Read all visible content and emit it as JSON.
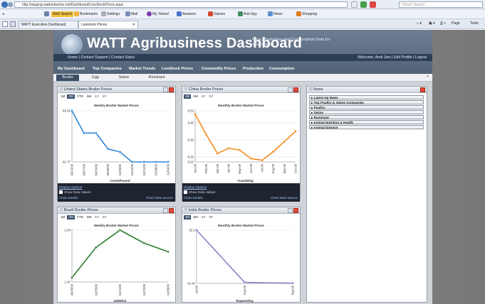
{
  "browser": {
    "url": "http://staging.wattnetworks.net/Dashboard/LiveStockPrices.aspx",
    "search_placeholder": "Yahoo! Search",
    "toolbar": [
      "Web Search",
      "Bookmarks",
      "Settings",
      "Mail",
      "My Yahoo!",
      "Answers",
      "Games",
      "Anti-Spy",
      "News",
      "Shopping"
    ],
    "tabs": [
      "WATT Executive Dashboard",
      "Livestock Prices"
    ],
    "right_tools": [
      "Page",
      "Tools"
    ]
  },
  "header": {
    "title": "WATT Agribusiness Dashboard",
    "subtitle": "Price, Production and Consumption Data for Your World",
    "topnav_left": "Home | Contact Support | Contact Sales",
    "topnav_right": "Welcome, Amit Jain | Edit Profile | Logout"
  },
  "mainnav": [
    "My Dashboard",
    "Top Companies",
    "Market Trends",
    "LiveStock Prices",
    "Commodity Prices",
    "Production",
    "Consumption"
  ],
  "subnav": [
    "Broiler",
    "Egg",
    "Swine",
    "Ruminant"
  ],
  "footer_labels": {
    "display_options": "Display Options",
    "show_values": "Show Data Values",
    "chart_details": "Chart Details",
    "chart_source": "Chart Data Source"
  },
  "panels": {
    "us": {
      "title": "United States Broiler Prices",
      "ranges": [
        "1M",
        "3M",
        "YTD",
        "6M",
        "1Y",
        "2Y"
      ],
      "selected": "3M"
    },
    "china": {
      "title": "China Broiler Prices",
      "ranges": [
        "3M",
        "6M",
        "1Y",
        "2Y"
      ],
      "selected": "3M"
    },
    "brazil": {
      "title": "Brazil Broiler Prices",
      "ranges": [
        "1M",
        "3M",
        "YTD",
        "6M",
        "1Y",
        "2Y"
      ],
      "selected": "3M"
    },
    "india": {
      "title": "India Broiler Prices",
      "ranges": [
        "3M",
        "6M",
        "1Y",
        "2Y"
      ],
      "selected": "3M"
    }
  },
  "news": {
    "title": "News",
    "items": [
      "Latest Ag News",
      "Top Poultry & Swine Companies",
      "Poultry",
      "Swine",
      "Ruminant",
      "Animal Nutrition & Health",
      "Animal Disease"
    ]
  },
  "chart_data": [
    {
      "type": "line",
      "title": "Weekly Broiler Market Prices",
      "x": [
        "09/10/09",
        "09/17/09",
        "09/24/09",
        "09/30/09",
        "10/05/09",
        "10/14/09",
        "10/21/09",
        "10/28/09",
        "11/04/09"
      ],
      "values": [
        85.01,
        83.6,
        83.6,
        82.6,
        82.4,
        81.77,
        81.77,
        81.77,
        81.77
      ],
      "ylim": [
        81.77,
        85.01
      ],
      "ytick_labels": [
        "85.01",
        "81.77"
      ],
      "xlabel": "Cents/Pound",
      "color": "#2f86d6"
    },
    {
      "type": "line",
      "title": "Monthly Broiler Market Prices",
      "x": [
        "Jan-09",
        "Feb-09",
        "Mar-09",
        "Apr-09",
        "May-09",
        "Jun-09",
        "Jul-09",
        "Aug-09",
        "Sep-09",
        "Oct-09"
      ],
      "values": [
        8.5,
        8.38,
        8.27,
        8.3,
        8.29,
        8.24,
        8.23,
        8.28,
        8.34,
        8.4
      ],
      "ylim": [
        8.22,
        8.52
      ],
      "ytick_labels": [
        "8.52",
        "8.45",
        "8.35",
        "8.25",
        "8.22"
      ],
      "xlabel": "Yuan/500g",
      "color": "#f08a1c"
    },
    {
      "type": "line",
      "title": "Weekly Broiler Market Prices",
      "x": [
        "09/28/09",
        "10/05/09",
        "10/14/09",
        "10/22/09",
        "10/28/09"
      ],
      "values": [
        1.43,
        1.5,
        1.54,
        1.51,
        1.49
      ],
      "ylim": [
        1.42,
        1.54
      ],
      "ytick_labels": [
        "1.54",
        "1.42"
      ],
      "xlabel": "USD/KG",
      "color": "#2e7d2e"
    },
    {
      "type": "line",
      "title": "Monthly Broiler Market Prices",
      "x": [
        "Jul-09",
        "Aug-09",
        "Sep-09"
      ],
      "values": [
        62.1,
        42.8,
        42.5
      ],
      "ylim": [
        42.43,
        62.1
      ],
      "ytick_labels": [
        "62.1",
        "42.43"
      ],
      "xlabel": "Rupees/Kg",
      "color": "#8b7fc7"
    }
  ]
}
